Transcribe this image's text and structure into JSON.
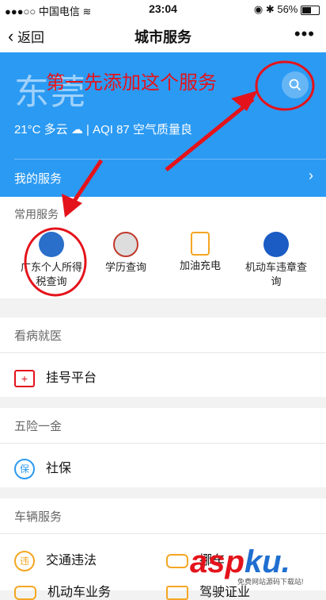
{
  "status": {
    "carrier": "中国电信",
    "time": "23:04",
    "battery": "56%"
  },
  "nav": {
    "back": "返回",
    "title": "城市服务",
    "more": "•••"
  },
  "hero": {
    "city": "东莞",
    "weather": "21°C 多云 ☁ | AQI 87 空气质量良",
    "my_services": "我的服务",
    "arrow": "›"
  },
  "annotation": {
    "text": "第一先添加这个服务"
  },
  "frequent": {
    "label": "常用服务",
    "items": [
      {
        "label": "广东个人所得税查询"
      },
      {
        "label": "学历查询"
      },
      {
        "label": "加油充电"
      },
      {
        "label": "机动车违章查询"
      }
    ]
  },
  "sections": [
    {
      "title": "看病就医",
      "items": [
        {
          "label": "挂号平台"
        }
      ]
    },
    {
      "title": "五险一金",
      "items": [
        {
          "label": "社保"
        }
      ]
    },
    {
      "title": "车辆服务",
      "items": [
        {
          "label": "交通违法"
        },
        {
          "label": "挪车"
        },
        {
          "label": "机动车业务"
        },
        {
          "label": "驾驶证业"
        }
      ]
    }
  ],
  "watermark": {
    "asp": "asp",
    "ku": "ku",
    "dot": ".",
    "sub": "免费网站源码下载站!"
  },
  "colors": {
    "hero": "#2b9af3",
    "annotation": "#e4131b",
    "accent": "#f5a623"
  }
}
